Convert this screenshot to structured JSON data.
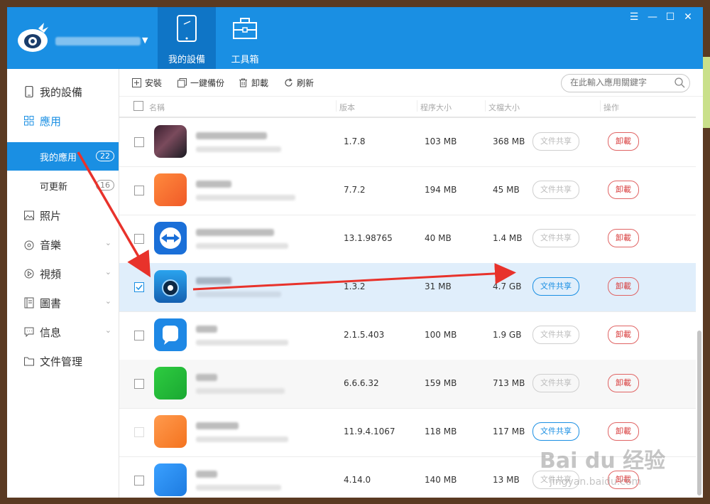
{
  "topbar": {
    "tabs": [
      {
        "label": "我的設備",
        "icon": "tablet-icon",
        "active": true
      },
      {
        "label": "工具箱",
        "icon": "toolbox-icon",
        "active": false
      }
    ],
    "window_controls": [
      "menu-icon",
      "minimize-icon",
      "maximize-icon",
      "close-icon"
    ],
    "accent": "#1a8fe3"
  },
  "sidebar": {
    "items": [
      {
        "label": "我的設備",
        "icon": "phone-icon"
      },
      {
        "label": "應用",
        "icon": "grid-icon"
      },
      {
        "label": "照片",
        "icon": "picture-icon"
      },
      {
        "label": "音樂",
        "icon": "music-icon"
      },
      {
        "label": "視頻",
        "icon": "video-icon"
      },
      {
        "label": "圖書",
        "icon": "book-icon"
      },
      {
        "label": "信息",
        "icon": "message-icon"
      },
      {
        "label": "文件管理",
        "icon": "folder-icon"
      }
    ],
    "subitems": [
      {
        "label": "我的應用",
        "count": "22",
        "active": true
      },
      {
        "label": "可更新",
        "count": "16",
        "active": false
      }
    ]
  },
  "toolbar": {
    "install": "安裝",
    "backup": "一鍵備份",
    "uninstall": "卸載",
    "refresh": "刷新",
    "search_placeholder": "在此輸入應用關鍵字"
  },
  "table": {
    "headers": {
      "name": "名稱",
      "version": "版本",
      "app_size": "程序大小",
      "doc_size": "文檔大小",
      "actions": "操作"
    },
    "share_label": "文件共享",
    "uninstall_label": "卸載",
    "rows": [
      {
        "version": "1.7.8",
        "app_size": "103 MB",
        "doc_size": "368 MB",
        "checked": false,
        "share_enabled": false
      },
      {
        "version": "7.7.2",
        "app_size": "194 MB",
        "doc_size": "45 MB",
        "checked": false,
        "share_enabled": false
      },
      {
        "version": "13.1.98765",
        "app_size": "40 MB",
        "doc_size": "1.4 MB",
        "checked": false,
        "share_enabled": false
      },
      {
        "version": "1.3.2",
        "app_size": "31 MB",
        "doc_size": "4.7 GB",
        "checked": true,
        "share_enabled": true
      },
      {
        "version": "2.1.5.403",
        "app_size": "100 MB",
        "doc_size": "1.9 GB",
        "checked": false,
        "share_enabled": false
      },
      {
        "version": "6.6.6.32",
        "app_size": "159 MB",
        "doc_size": "713 MB",
        "checked": false,
        "share_enabled": false
      },
      {
        "version": "11.9.4.1067",
        "app_size": "118 MB",
        "doc_size": "117 MB",
        "checked": false,
        "share_enabled": true
      },
      {
        "version": "4.14.0",
        "app_size": "140 MB",
        "doc_size": "13 MB",
        "checked": false,
        "share_enabled": false
      }
    ]
  },
  "watermark": {
    "text": "Bai du 经验",
    "sub": "jingyan.baidu.com"
  }
}
